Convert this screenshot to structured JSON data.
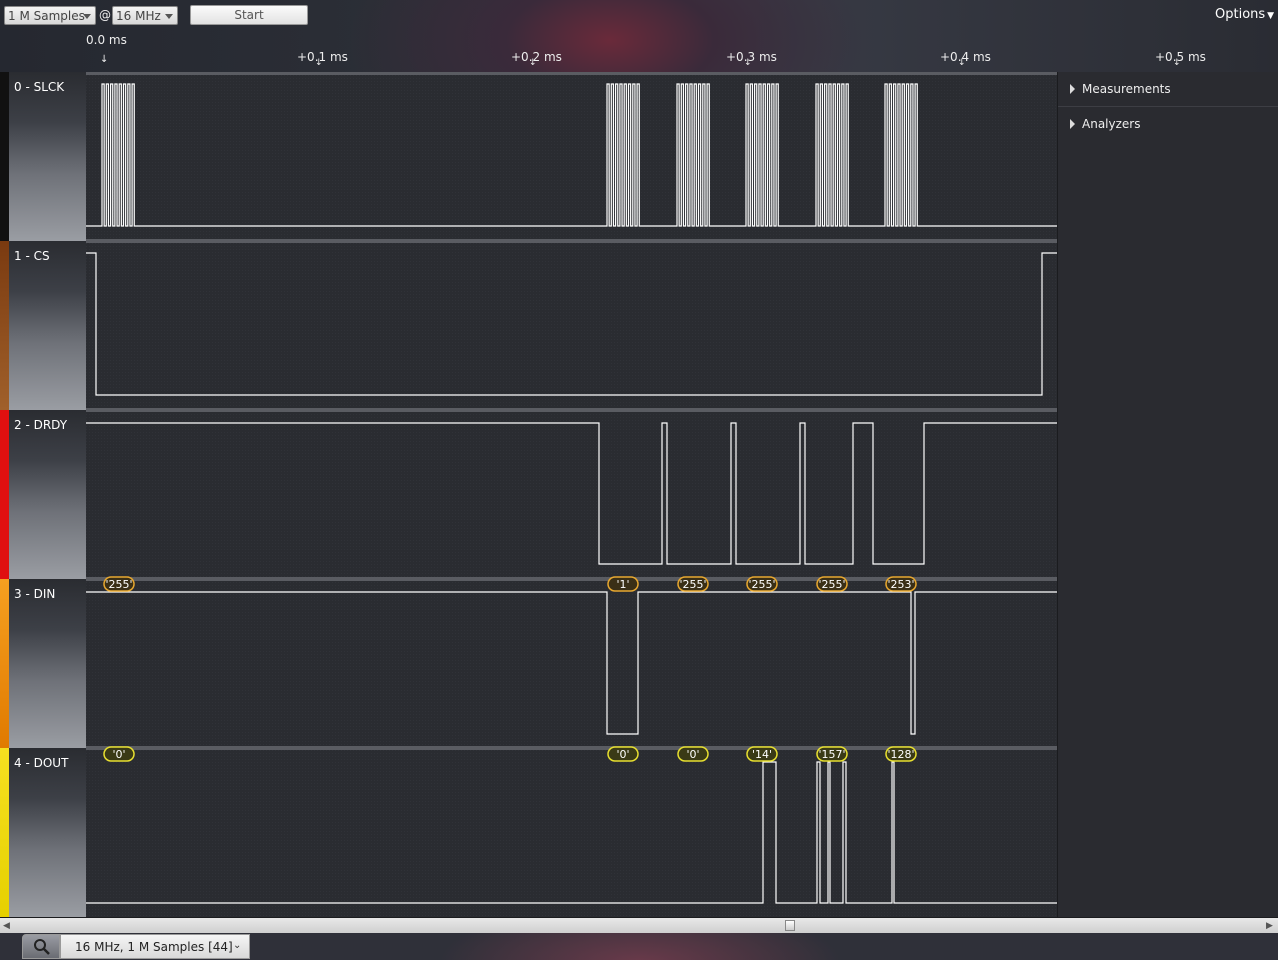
{
  "toolbar": {
    "samples_value": "1 M Samples",
    "at_symbol": "@",
    "rate_value": "16 MHz",
    "start_label": "Start",
    "options_label": "Options"
  },
  "timeline": {
    "origin_label": "0.0 ms",
    "ticks": [
      "+0.1 ms",
      "+0.2 ms",
      "+0.3 ms",
      "+0.4 ms",
      "+0.5 ms"
    ]
  },
  "channels": [
    {
      "label": "0 - SLCK",
      "color": "#111111"
    },
    {
      "label": "1 - CS",
      "color": "#8a4a1a"
    },
    {
      "label": "2 - DRDY",
      "color": "#e01010"
    },
    {
      "label": "3 - DIN",
      "color": "#f08a10"
    },
    {
      "label": "4 - DOUT",
      "color": "#f0e010"
    }
  ],
  "decoded": {
    "din": [
      "'255'",
      "'1'",
      "'255'",
      "'255'",
      "'255'",
      "'253'"
    ],
    "dout": [
      "'0'",
      "'0'",
      "'0'",
      "'14'",
      "'157'",
      "'128'"
    ]
  },
  "side_panel": {
    "measurements_label": "Measurements",
    "analyzers_label": "Analyzers"
  },
  "tab": {
    "label": "16 MHz, 1 M Samples [44]"
  },
  "icons": {
    "search": "magnifier-icon",
    "dropdown": "chevron-down-icon"
  }
}
